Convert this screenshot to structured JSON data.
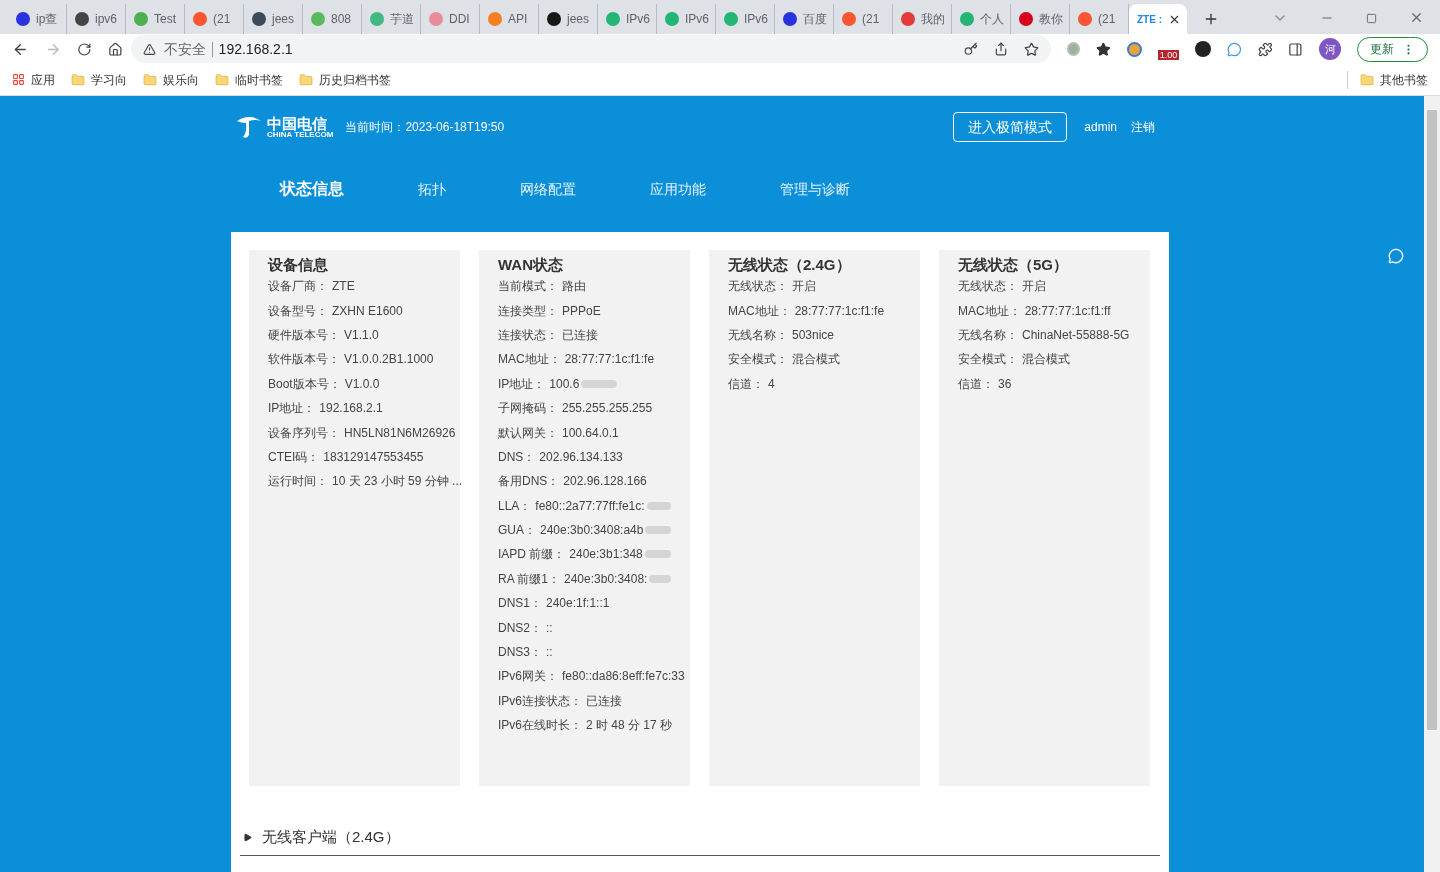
{
  "browser": {
    "tabs": [
      {
        "title": "ip查",
        "color": "#2932e1",
        "selected": false
      },
      {
        "title": "ipv6",
        "color": "#444444",
        "selected": false
      },
      {
        "title": "Test",
        "color": "#4caf50",
        "selected": false
      },
      {
        "title": "(21",
        "color": "#fc5531",
        "selected": false
      },
      {
        "title": "jees",
        "color": "#3c4a5a",
        "selected": false
      },
      {
        "title": "808",
        "color": "#5cb85c",
        "selected": false
      },
      {
        "title": "芋道",
        "color": "#43b883",
        "selected": false
      },
      {
        "title": "DDI",
        "color": "#e98c9a",
        "selected": false
      },
      {
        "title": "API",
        "color": "#f48120",
        "selected": false
      },
      {
        "title": "jees",
        "color": "#181717",
        "selected": false
      },
      {
        "title": "IPv6",
        "color": "#22b573",
        "selected": false
      },
      {
        "title": "IPv6",
        "color": "#22b573",
        "selected": false
      },
      {
        "title": "IPv6",
        "color": "#22b573",
        "selected": false
      },
      {
        "title": "百度",
        "color": "#2932e1",
        "selected": false
      },
      {
        "title": "(21",
        "color": "#fc5531",
        "selected": false
      },
      {
        "title": "我的",
        "color": "#e5393a",
        "selected": false
      },
      {
        "title": "个人",
        "color": "#22b573",
        "selected": false
      },
      {
        "title": "教你",
        "color": "#d6001c",
        "selected": false
      },
      {
        "title": "(21",
        "color": "#fc5531",
        "selected": false
      },
      {
        "title": "ZTE :",
        "color": "#1e88e5",
        "selected": true
      }
    ],
    "security": "不安全",
    "url": "192.168.2.1",
    "update_button": "更新",
    "avatar": "河",
    "badge": "1.00",
    "bookmarks": [
      "应用",
      "学习向",
      "娱乐向",
      "临时书签",
      "历史归档书签"
    ],
    "other_bookmarks": "其他书签"
  },
  "header": {
    "logo_cn": "中国电信",
    "logo_en": "CHINA TELECOM",
    "time": "当前时间：2023-06-18T19:50",
    "simple_mode_button": "进入极简模式",
    "user": "admin",
    "logout": "注销"
  },
  "nav": [
    {
      "label": "状态信息",
      "selected": true
    },
    {
      "label": "拓扑",
      "selected": false
    },
    {
      "label": "网络配置",
      "selected": false
    },
    {
      "label": "应用功能",
      "selected": false
    },
    {
      "label": "管理与诊断",
      "selected": false
    }
  ],
  "cards": [
    {
      "title": "设备信息",
      "rows": [
        {
          "label": "设备厂商：",
          "value": "ZTE"
        },
        {
          "label": "设备型号：",
          "value": "ZXHN E1600"
        },
        {
          "label": "硬件版本号：",
          "value": "V1.1.0"
        },
        {
          "label": "软件版本号：",
          "value": "V1.0.0.2B1.1000"
        },
        {
          "label": "Boot版本号：",
          "value": "V1.0.0"
        },
        {
          "label": "IP地址：",
          "value": "192.168.2.1"
        },
        {
          "label": "设备序列号：",
          "value": "HN5LN81N6M26926"
        },
        {
          "label": "CTEI码：",
          "value": "183129147553455"
        },
        {
          "label": "运行时间：",
          "value": "10 天 23 小时 59 分钟 ..."
        }
      ]
    },
    {
      "title": "WAN状态",
      "rows": [
        {
          "label": "当前模式：",
          "value": "路由"
        },
        {
          "label": "连接类型：",
          "value": "PPPoE"
        },
        {
          "label": "连接状态：",
          "value": "已连接"
        },
        {
          "label": "MAC地址：",
          "value": "28:77:77:1c:f1:fe"
        },
        {
          "label": "IP地址：",
          "value": "100.6",
          "redacted": true
        },
        {
          "label": "子网掩码：",
          "value": "255.255.255.255"
        },
        {
          "label": "默认网关：",
          "value": "100.64.0.1"
        },
        {
          "label": "DNS：",
          "value": "202.96.134.133"
        },
        {
          "label": "备用DNS：",
          "value": "202.96.128.166"
        },
        {
          "label": "LLA：",
          "value": "fe80::2a77:77ff:fe1c:",
          "redacted": true
        },
        {
          "label": "GUA：",
          "value": "240e:3b0:3408:a4b",
          "redacted": true
        },
        {
          "label": "IAPD 前缀：",
          "value": "240e:3b1:348",
          "redacted": true
        },
        {
          "label": "RA 前缀1：",
          "value": "240e:3b0:3408:",
          "redacted": true
        },
        {
          "label": "DNS1：",
          "value": "240e:1f:1::1"
        },
        {
          "label": "DNS2：",
          "value": "::"
        },
        {
          "label": "DNS3：",
          "value": "::"
        },
        {
          "label": "IPv6网关：",
          "value": "fe80::da86:8eff:fe7c:33"
        },
        {
          "label": "IPv6连接状态：",
          "value": "已连接"
        },
        {
          "label": "IPv6在线时长：",
          "value": "2 时 48 分 17 秒"
        }
      ]
    },
    {
      "title": "无线状态（2.4G）",
      "rows": [
        {
          "label": "无线状态：",
          "value": "开启"
        },
        {
          "label": "MAC地址：",
          "value": "28:77:77:1c:f1:fe"
        },
        {
          "label": "无线名称：",
          "value": "503nice"
        },
        {
          "label": "安全模式：",
          "value": "混合模式"
        },
        {
          "label": "信道：",
          "value": "4"
        }
      ]
    },
    {
      "title": "无线状态（5G）",
      "rows": [
        {
          "label": "无线状态：",
          "value": "开启"
        },
        {
          "label": "MAC地址：",
          "value": "28:77:77:1c:f1:ff"
        },
        {
          "label": "无线名称：",
          "value": "ChinaNet-55888-5G"
        },
        {
          "label": "安全模式：",
          "value": "混合模式"
        },
        {
          "label": "信道：",
          "value": "36"
        }
      ]
    }
  ],
  "sections": [
    {
      "title": "无线客户端（2.4G）",
      "expanded": false
    }
  ]
}
